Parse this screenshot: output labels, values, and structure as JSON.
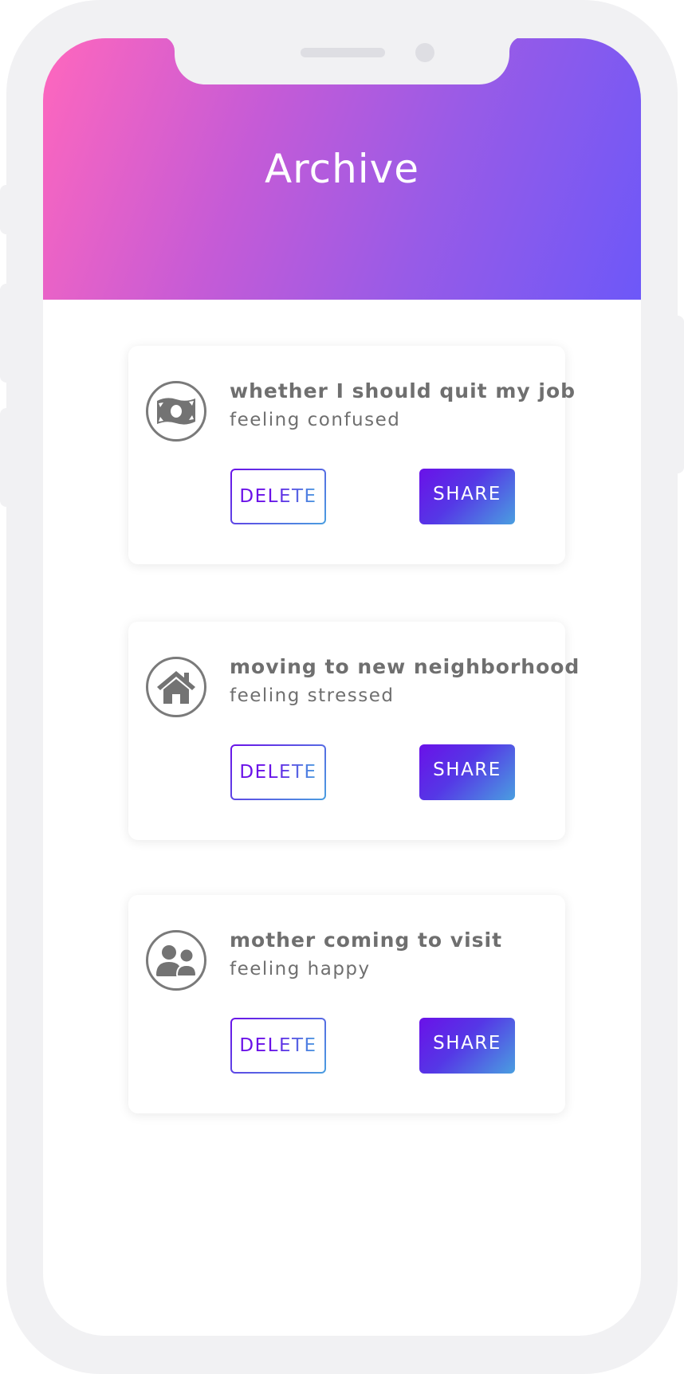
{
  "header": {
    "title": "Archive"
  },
  "colors": {
    "header_gradient_start": "#ff67bd",
    "header_gradient_end": "#6d58f8",
    "button_gradient_start": "#6a11e8",
    "button_gradient_end": "#4a9fe0",
    "text_gray": "#6f6f6f"
  },
  "cards": [
    {
      "icon": "money-bill-icon",
      "title": "whether I should quit my job",
      "subtitle": "feeling confused",
      "delete_label": "DELETE",
      "share_label": "SHARE"
    },
    {
      "icon": "house-icon",
      "title": "moving to new neighborhood",
      "subtitle": "feeling stressed",
      "delete_label": "DELETE",
      "share_label": "SHARE"
    },
    {
      "icon": "users-icon",
      "title": "mother coming to visit",
      "subtitle": "feeling happy",
      "delete_label": "DELETE",
      "share_label": "SHARE"
    }
  ]
}
